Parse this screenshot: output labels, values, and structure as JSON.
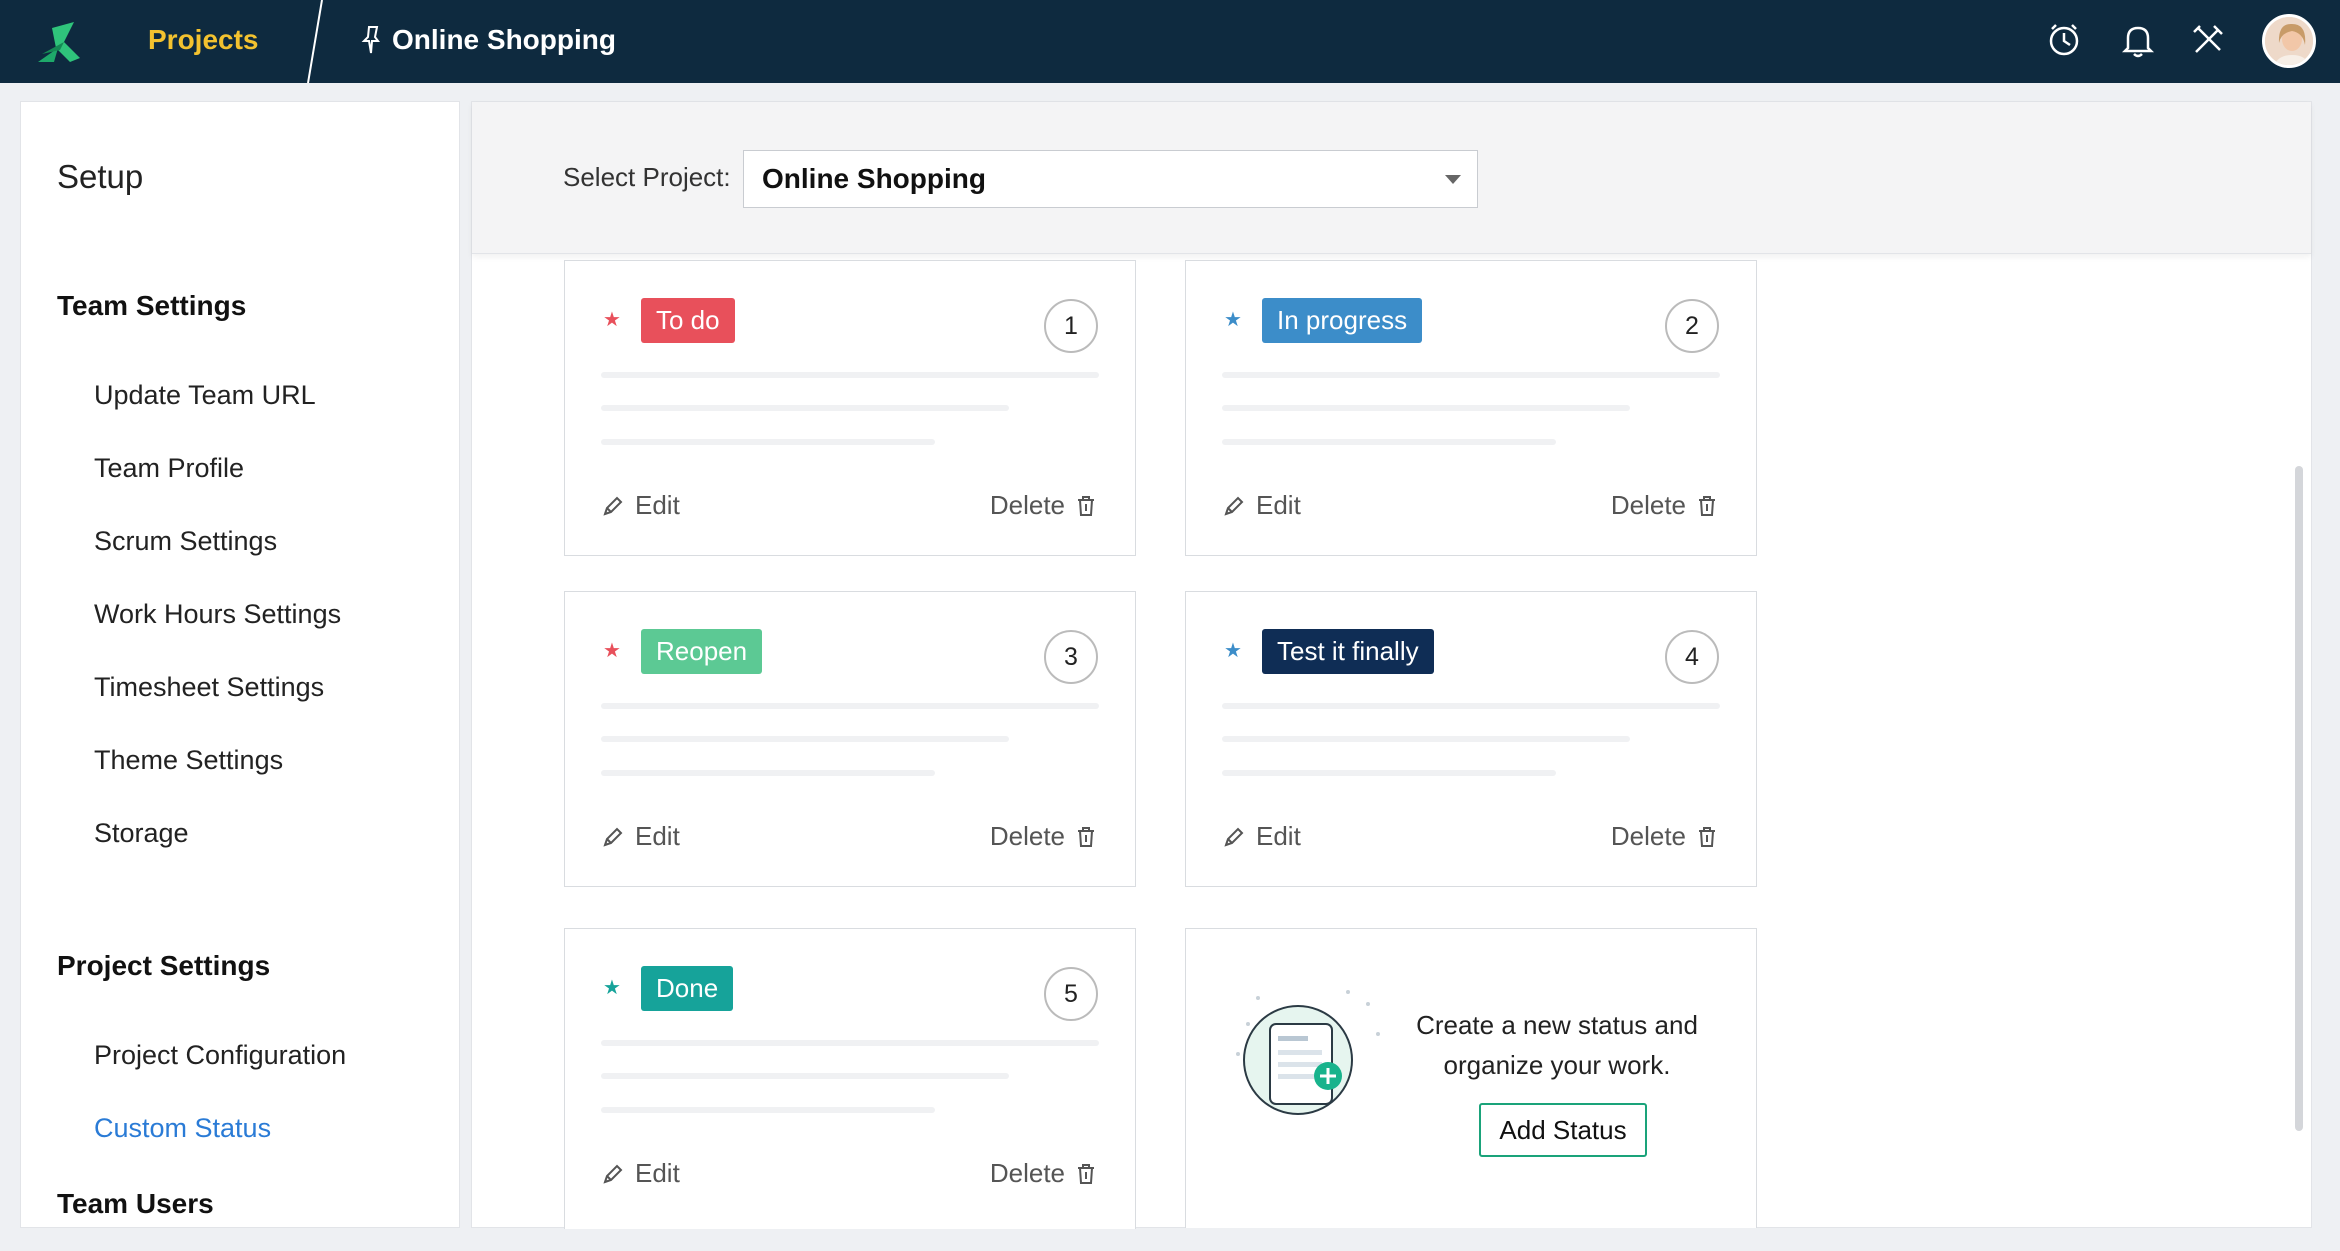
{
  "header": {
    "nav_projects": "Projects",
    "project_name": "Online Shopping",
    "icons": [
      "logo-icon",
      "pin-icon",
      "timer-icon",
      "bell-icon",
      "tools-icon",
      "avatar"
    ]
  },
  "sidebar": {
    "title": "Setup",
    "team_settings": {
      "heading": "Team Settings",
      "items": [
        "Update Team URL",
        "Team Profile",
        "Scrum Settings",
        "Work Hours Settings",
        "Timesheet Settings",
        "Theme Settings",
        "Storage"
      ]
    },
    "project_settings": {
      "heading": "Project Settings",
      "items": [
        "Project Configuration",
        "Custom Status"
      ],
      "active": "Custom Status"
    },
    "team_users": {
      "heading": "Team Users"
    }
  },
  "filter": {
    "label": "Select Project:",
    "selected": "Online Shopping"
  },
  "statuses": [
    {
      "name": "To do",
      "order": "1",
      "color": "#e8505b",
      "star_color": "#e8505b",
      "edit": "Edit",
      "delete": "Delete"
    },
    {
      "name": "In progress",
      "order": "2",
      "color": "#3c8dc9",
      "star_color": "#3c8dc9",
      "edit": "Edit",
      "delete": "Delete"
    },
    {
      "name": "Reopen",
      "order": "3",
      "color": "#5cc994",
      "star_color": "#e8505b",
      "edit": "Edit",
      "delete": "Delete"
    },
    {
      "name": "Test it finally",
      "order": "4",
      "color": "#0f2d55",
      "star_color": "#3c8dc9",
      "edit": "Edit",
      "delete": "Delete"
    },
    {
      "name": "Done",
      "order": "5",
      "color": "#16a39a",
      "star_color": "#16a39a",
      "edit": "Edit",
      "delete": "Delete"
    }
  ],
  "add_status": {
    "text": "Create a new status and organize your work.",
    "button": "Add Status"
  },
  "colors": {
    "topbar": "#0e2a3f",
    "accent_yellow": "#f3c22f",
    "link_blue": "#2a7bd6",
    "add_green": "#1aa37a"
  }
}
